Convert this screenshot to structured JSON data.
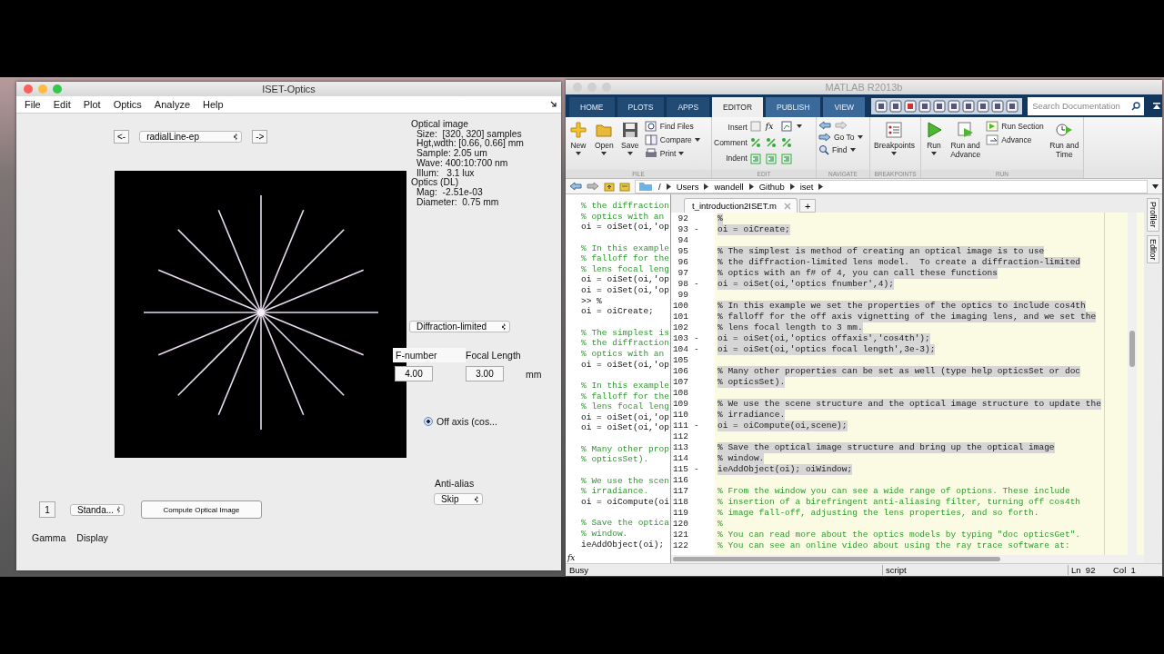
{
  "iset_window": {
    "title": "ISET-Optics",
    "menu": [
      "File",
      "Edit",
      "Plot",
      "Optics",
      "Analyze",
      "Help"
    ],
    "prev_button": "<-",
    "scene_select": "radialLine-ep",
    "next_button": "->",
    "info": [
      {
        "kind": "header",
        "text": "Optical image"
      },
      {
        "kind": "item",
        "text": "Size:  [320, 320] samples"
      },
      {
        "kind": "item",
        "text": "Hgt,wdth: [0.66, 0.66] mm"
      },
      {
        "kind": "item",
        "text": "Sample: 2.05 um"
      },
      {
        "kind": "item",
        "text": "Wave: 400:10:700 nm"
      },
      {
        "kind": "item",
        "text": "Illum:   3.1 lux"
      },
      {
        "kind": "header",
        "text": "Optics (DL)"
      },
      {
        "kind": "item",
        "text": "Mag:  -2.51e-03"
      },
      {
        "kind": "item",
        "text": "Diameter:  0.75 mm"
      }
    ],
    "optics_model": "Diffraction-limited",
    "fnumber": {
      "label": "F-number",
      "value": "4.00"
    },
    "focal_length": {
      "label": "Focal Length",
      "value": "3.00",
      "unit": "mm"
    },
    "off_axis": {
      "label": "Off axis (cos...",
      "selected": true
    },
    "anti_alias": {
      "label": "Anti-alias",
      "value": "Skip"
    },
    "gamma": {
      "value": "1",
      "label": "Gamma"
    },
    "display": {
      "value": "Standa...",
      "label": "Display"
    },
    "compute_button": "Compute Optical Image"
  },
  "matlab_window": {
    "title": "MATLAB R2013b",
    "tabs": [
      {
        "label": "HOME",
        "selected": false
      },
      {
        "label": "PLOTS",
        "selected": false
      },
      {
        "label": "APPS",
        "selected": false
      },
      {
        "label": "EDITOR",
        "selected": true
      },
      {
        "label": "PUBLISH",
        "selected": false
      },
      {
        "label": "VIEW",
        "selected": false
      }
    ],
    "search": {
      "placeholder": "Search Documentation"
    },
    "toolstrip": {
      "file": {
        "label": "FILE",
        "new": "New",
        "open": "Open",
        "save": "Save",
        "find_files": "Find Files",
        "compare": "Compare",
        "print": "Print"
      },
      "edit": {
        "label": "EDIT",
        "insert": "Insert",
        "fx": "fx",
        "comment": "Comment",
        "indent": "Indent"
      },
      "navigate": {
        "label": "NAVIGATE",
        "go_to": "Go To",
        "find": "Find"
      },
      "breakpoints": {
        "label": "BREAKPOINTS",
        "breakpoints": "Breakpoints"
      },
      "run": {
        "label": "RUN",
        "run": "Run",
        "run_and_advance": "Run and Advance",
        "run_section": "Run Section",
        "advance": "Advance",
        "run_and_time": "Run and Time"
      }
    },
    "path": [
      "/",
      "Users",
      "wandell",
      "Github",
      "iset"
    ],
    "command_window": {
      "lines": [
        {
          "kind": "comment",
          "text": "% the diffraction"
        },
        {
          "kind": "comment",
          "text": "% optics with an"
        },
        {
          "kind": "code",
          "text": "oi = oiSet(oi,'op"
        },
        {
          "kind": "blank"
        },
        {
          "kind": "comment",
          "text": "% In this example"
        },
        {
          "kind": "comment",
          "text": "% falloff for the"
        },
        {
          "kind": "comment",
          "text": "% lens focal leng"
        },
        {
          "kind": "code",
          "text": "oi = oiSet(oi,'op"
        },
        {
          "kind": "code",
          "text": "oi = oiSet(oi,'op"
        },
        {
          "kind": "prompt",
          "text": ">> %"
        },
        {
          "kind": "code",
          "text": "oi = oiCreate;"
        },
        {
          "kind": "blank"
        },
        {
          "kind": "comment",
          "text": "% The simplest is"
        },
        {
          "kind": "comment",
          "text": "% the diffraction"
        },
        {
          "kind": "comment",
          "text": "% optics with an"
        },
        {
          "kind": "code",
          "text": "oi = oiSet(oi,'op"
        },
        {
          "kind": "blank"
        },
        {
          "kind": "comment",
          "text": "% In this example"
        },
        {
          "kind": "comment",
          "text": "% falloff for the"
        },
        {
          "kind": "comment",
          "text": "% lens focal leng"
        },
        {
          "kind": "code",
          "text": "oi = oiSet(oi,'op"
        },
        {
          "kind": "code",
          "text": "oi = oiSet(oi,'op"
        },
        {
          "kind": "blank"
        },
        {
          "kind": "comment",
          "text": "% Many other prop"
        },
        {
          "kind": "comment",
          "text": "% opticsSet)."
        },
        {
          "kind": "blank"
        },
        {
          "kind": "comment",
          "text": "% We use the scen"
        },
        {
          "kind": "comment",
          "text": "% irradiance."
        },
        {
          "kind": "code",
          "text": "oi = oiCompute(oi"
        },
        {
          "kind": "blank"
        },
        {
          "kind": "comment",
          "text": "% Save the optica"
        },
        {
          "kind": "comment",
          "text": "% window."
        },
        {
          "kind": "code",
          "text": "ieAddObject(oi);"
        }
      ],
      "prompt_label": "fx"
    },
    "editor": {
      "tab": "t_introduction2ISET.m",
      "new_tab": "+",
      "lines": [
        {
          "num": "92",
          "kind": "comment",
          "code": "%",
          "selected": true
        },
        {
          "num": "93",
          "marker": "-",
          "kind": "code",
          "code": "oi = oiCreate;",
          "selected": true
        },
        {
          "num": "94"
        },
        {
          "num": "95",
          "kind": "comment",
          "code": "% The simplest is method of creating an optical image is to use",
          "selected": true
        },
        {
          "num": "96",
          "kind": "comment",
          "code": "% the diffraction-limited lens model.  To create a diffraction-limited",
          "selected": true
        },
        {
          "num": "97",
          "kind": "comment",
          "code": "% optics with an f# of 4, you can call these functions",
          "selected": true
        },
        {
          "num": "98",
          "marker": "-",
          "kind": "code",
          "code": "oi = oiSet(oi,'optics fnumber',4);",
          "selected": true
        },
        {
          "num": "99"
        },
        {
          "num": "100",
          "kind": "comment",
          "code": "% In this example we set the properties of the optics to include cos4th",
          "selected": true
        },
        {
          "num": "101",
          "kind": "comment",
          "code": "% falloff for the off axis vignetting of the imaging lens, and we set the",
          "selected": true
        },
        {
          "num": "102",
          "kind": "comment",
          "code": "% lens focal length to 3 mm.",
          "selected": true
        },
        {
          "num": "103",
          "marker": "-",
          "kind": "code",
          "code": "oi = oiSet(oi,'optics offaxis','cos4th');",
          "selected": true
        },
        {
          "num": "104",
          "marker": "-",
          "kind": "code",
          "code": "oi = oiSet(oi,'optics focal length',3e-3);",
          "selected": true
        },
        {
          "num": "105"
        },
        {
          "num": "106",
          "kind": "comment",
          "code": "% Many other properties can be set as well (type help opticsSet or doc",
          "selected": true
        },
        {
          "num": "107",
          "kind": "comment",
          "code": "% opticsSet).",
          "selected": true
        },
        {
          "num": "108"
        },
        {
          "num": "109",
          "kind": "comment",
          "code": "% We use the scene structure and the optical image structure to update the",
          "selected": true
        },
        {
          "num": "110",
          "kind": "comment",
          "code": "% irradiance.",
          "selected": true
        },
        {
          "num": "111",
          "marker": "-",
          "kind": "code",
          "code": "oi = oiCompute(oi,scene);",
          "selected": true
        },
        {
          "num": "112"
        },
        {
          "num": "113",
          "kind": "comment",
          "code": "% Save the optical image structure and bring up the optical image",
          "selected": true
        },
        {
          "num": "114",
          "kind": "comment",
          "code": "% window.",
          "selected": true
        },
        {
          "num": "115",
          "marker": "-",
          "kind": "code",
          "code": "ieAddObject(oi); oiWindow;",
          "selected": true
        },
        {
          "num": "116"
        },
        {
          "num": "117",
          "kind": "comment",
          "code": "% From the window you can see a wide range of options. These include",
          "selected": false
        },
        {
          "num": "118",
          "kind": "comment",
          "code": "% insertion of a birefringent anti-aliasing filter, turning off cos4th",
          "selected": false
        },
        {
          "num": "119",
          "kind": "comment",
          "code": "% image fall-off, adjusting the lens properties, and so forth.",
          "selected": false
        },
        {
          "num": "120",
          "kind": "comment",
          "code": "%",
          "selected": false
        },
        {
          "num": "121",
          "kind": "comment",
          "code": "% You can read more about the optics models by typing \"doc opticsGet\".",
          "selected": false
        },
        {
          "num": "122",
          "kind": "comment",
          "code": "% You can see an online video about using the ray trace software at:",
          "selected": false
        }
      ]
    },
    "side_tabs": [
      "Profiler",
      "Editor"
    ],
    "status": {
      "state": "Busy",
      "type": "script",
      "ln": "Ln  92",
      "col": "Col  1"
    }
  }
}
